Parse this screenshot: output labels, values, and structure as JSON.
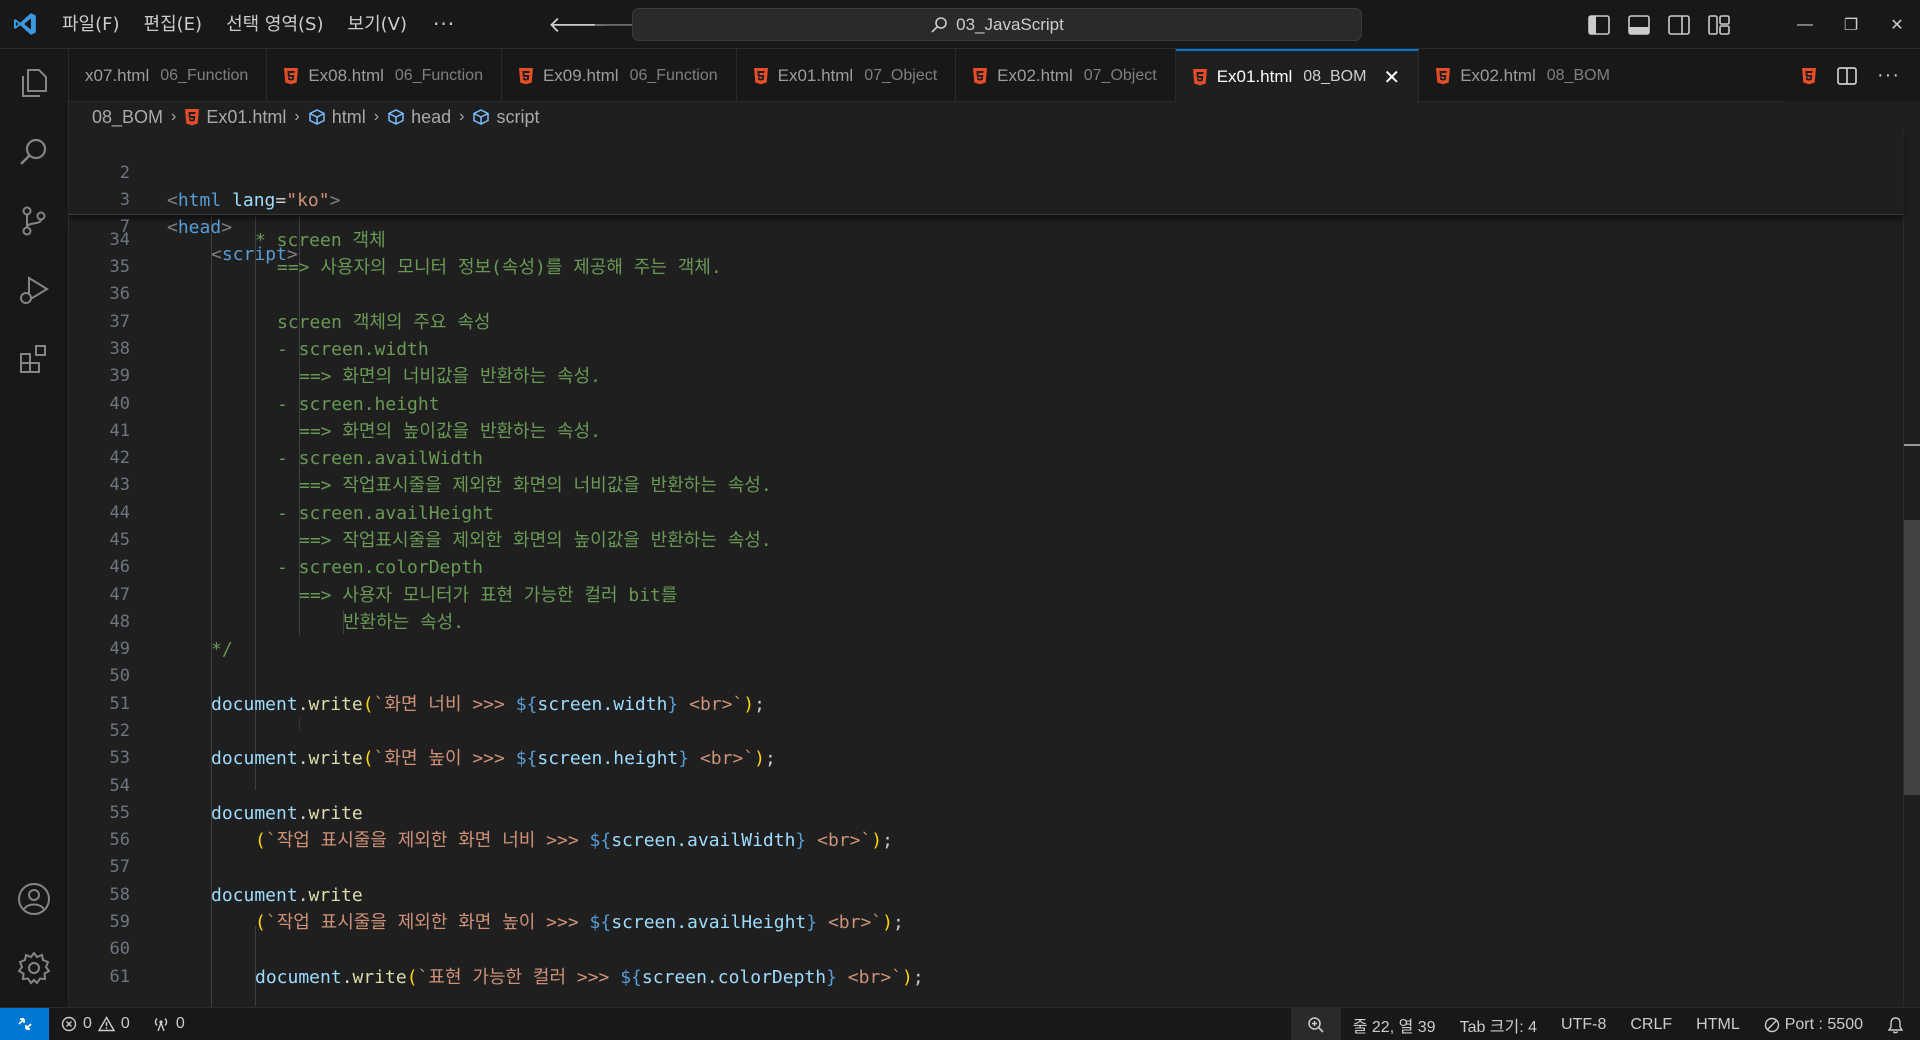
{
  "menu": {
    "items": [
      "파일(F)",
      "편집(E)",
      "선택 영역(S)",
      "보기(V)"
    ],
    "more": "···"
  },
  "search": {
    "label": "03_JavaScript"
  },
  "tabs": [
    {
      "name": "x07.html",
      "dir": "06_Function",
      "active": false
    },
    {
      "name": "Ex08.html",
      "dir": "06_Function",
      "active": false
    },
    {
      "name": "Ex09.html",
      "dir": "06_Function",
      "active": false
    },
    {
      "name": "Ex01.html",
      "dir": "07_Object",
      "active": false
    },
    {
      "name": "Ex02.html",
      "dir": "07_Object",
      "active": false
    },
    {
      "name": "Ex01.html",
      "dir": "08_BOM",
      "active": true
    },
    {
      "name": "Ex02.html",
      "dir": "08_BOM",
      "active": false
    }
  ],
  "tab_close": "✕",
  "breadcrumb": {
    "folder": "08_BOM",
    "file": "Ex01.html",
    "symbols": [
      "html",
      "head",
      "script"
    ]
  },
  "sticky_lines": [
    {
      "num": "2",
      "text": "<html lang=\"ko\">"
    },
    {
      "num": "3",
      "text": "<head>"
    },
    {
      "num": "7",
      "text": "<script>"
    }
  ],
  "code_lines": [
    {
      "num": "34",
      "text": "* screen 객체"
    },
    {
      "num": "35",
      "text": "==> 사용자의 모니터 정보(속성)를 제공해 주는 객체."
    },
    {
      "num": "36",
      "text": ""
    },
    {
      "num": "37",
      "text": "screen 객체의 주요 속성"
    },
    {
      "num": "38",
      "text": "- screen.width"
    },
    {
      "num": "39",
      "text": "==> 화면의 너비값을 반환하는 속성."
    },
    {
      "num": "40",
      "text": "- screen.height"
    },
    {
      "num": "41",
      "text": "==> 화면의 높이값을 반환하는 속성."
    },
    {
      "num": "42",
      "text": "- screen.availWidth"
    },
    {
      "num": "43",
      "text": "==> 작업표시줄을 제외한 화면의 너비값을 반환하는 속성."
    },
    {
      "num": "44",
      "text": "- screen.availHeight"
    },
    {
      "num": "45",
      "text": "==> 작업표시줄을 제외한 화면의 높이값을 반환하는 속성."
    },
    {
      "num": "46",
      "text": "- screen.colorDepth"
    },
    {
      "num": "47",
      "text": "==> 사용자 모니터가 표현 가능한 컬러 bit를"
    },
    {
      "num": "48",
      "text": "반환하는 속성."
    },
    {
      "num": "49",
      "text": "*/"
    },
    {
      "num": "50",
      "text": ""
    },
    {
      "num": "51",
      "obj": "document",
      "fn": "write",
      "tpl": "화면 너비 >>> ",
      "expr": "screen.width",
      "tail": " <br>"
    },
    {
      "num": "52",
      "text": ""
    },
    {
      "num": "53",
      "obj": "document",
      "fn": "write",
      "tpl": "화면 높이 >>> ",
      "expr": "screen.height",
      "tail": " <br>"
    },
    {
      "num": "54",
      "text": ""
    },
    {
      "num": "55",
      "obj": "document",
      "fn": "write"
    },
    {
      "num": "56",
      "tpl": "작업 표시줄을 제외한 화면 너비 >>> ",
      "expr": "screen.availWidth",
      "tail": " <br>"
    },
    {
      "num": "57",
      "text": ""
    },
    {
      "num": "58",
      "obj": "document",
      "fn": "write"
    },
    {
      "num": "59",
      "tpl": "작업 표시줄을 제외한 화면 높이 >>> ",
      "expr": "screen.availHeight",
      "tail": " <br>"
    },
    {
      "num": "60",
      "text": ""
    },
    {
      "num": "61",
      "obj": "document",
      "fn": "write",
      "tpl": "표현 가능한 컬러 >>> ",
      "expr": "screen.colorDepth",
      "tail": " <br>"
    }
  ],
  "status": {
    "errors": "0",
    "warnings": "0",
    "ports": "0",
    "position": "줄 22, 열 39",
    "tab_size": "Tab 크기: 4",
    "encoding": "UTF-8",
    "eol": "CRLF",
    "language": "HTML",
    "port": "Port : 5500"
  },
  "colors": {
    "accent": "#0078d4",
    "html_icon": "#e44d26",
    "tag": "#569cd6",
    "comment": "#6a9955",
    "string": "#ce9178",
    "function": "#dcdcaa",
    "variable": "#9cdcfe"
  }
}
